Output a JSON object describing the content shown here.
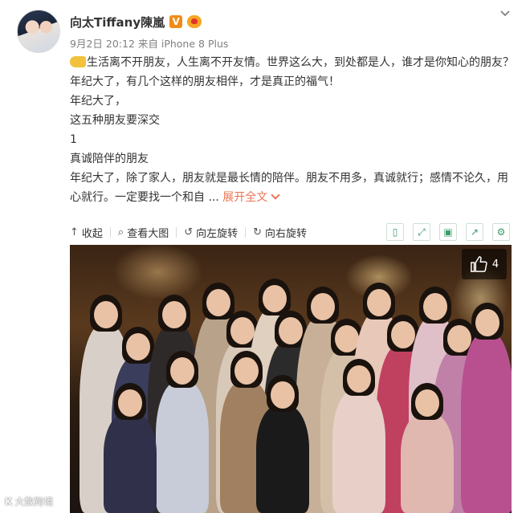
{
  "post": {
    "username": "向太Tiffany陳嵐",
    "verified_badge": "V",
    "meta": "9月2日 20:12 来自 iPhone 8 Plus",
    "text_lines": [
      "生活离不开朋友，人生离不开友情。世界这么大，到处都是人，谁才是你知心的朋友？年纪大了，有几个这样的朋友相伴，才是真正的福气！",
      "年纪大了，",
      "这五种朋友要深交",
      "1",
      "真诚陪伴的朋友",
      "年纪大了，除了家人，朋友就是最长情的陪伴。朋友不用多，真诚就行；感情不论久，用心就行。一定要找一个和自 ..."
    ],
    "expand_label": "展开全文",
    "icons": {
      "leading_emoji": "hand-icon",
      "menu": "chevron-down-icon",
      "vip": "vip-badge-icon"
    }
  },
  "toolbar": {
    "collapse_label": "收起",
    "view_large_label": "查看大图",
    "rotate_left_label": "向左旋转",
    "rotate_right_label": "向右旋转",
    "right_icons": [
      "phone-view-icon",
      "fullscreen-icon",
      "save-icon",
      "share-icon",
      "settings-icon"
    ]
  },
  "photo": {
    "like_count": "4"
  },
  "watermark": {
    "text": "大数跨境"
  },
  "colors": {
    "accent": "#eb7350",
    "verified": "#f08b16",
    "toolbar_icons": "#3a9a6a",
    "meta_text": "#808080"
  }
}
